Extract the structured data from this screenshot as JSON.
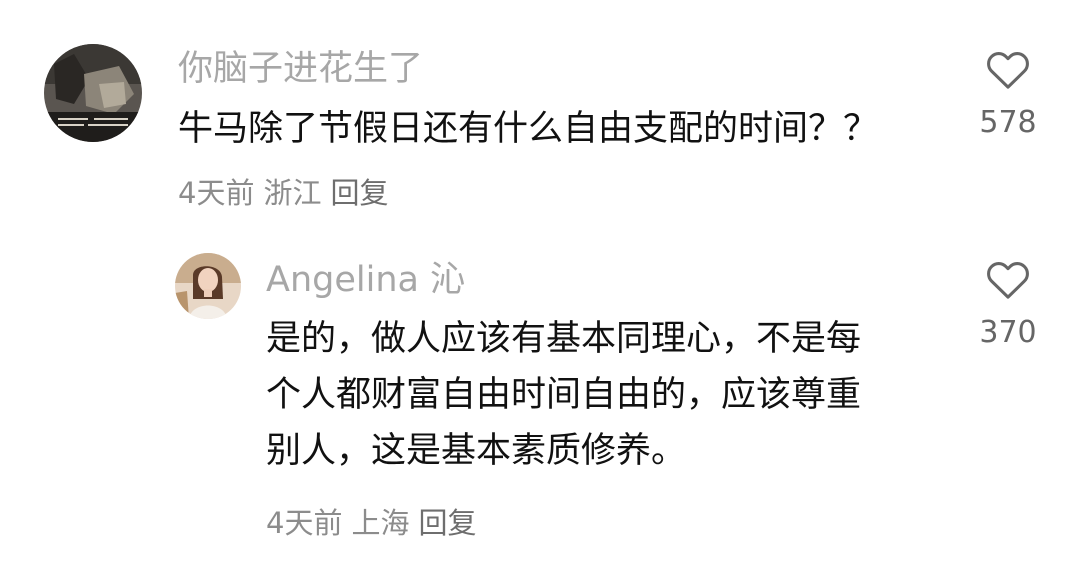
{
  "comment": {
    "username": "你脑子进花生了",
    "text": "牛马除了节假日还有什么自由支配的时间？？",
    "time": "4天前",
    "location": "浙江",
    "reply_label": "回复",
    "likes": "578",
    "avatar": "dark-photo-avatar",
    "like_icon": "heart-outline-icon"
  },
  "reply": {
    "username": "Angelina 沁",
    "text_lines": [
      "是的，做人应该有基本同理心，不是每",
      "个人都财富自由时间自由的，应该尊重",
      "别人，这是基本素质修养。"
    ],
    "time": "4天前",
    "location": "上海",
    "reply_label": "回复",
    "likes": "370",
    "avatar": "woman-photo-avatar",
    "like_icon": "heart-outline-icon"
  },
  "colors": {
    "username": "#a7a7a7",
    "body_text": "#111111",
    "meta": "#8c8c8c",
    "like_count": "#666666",
    "icon_stroke": "#666666"
  }
}
